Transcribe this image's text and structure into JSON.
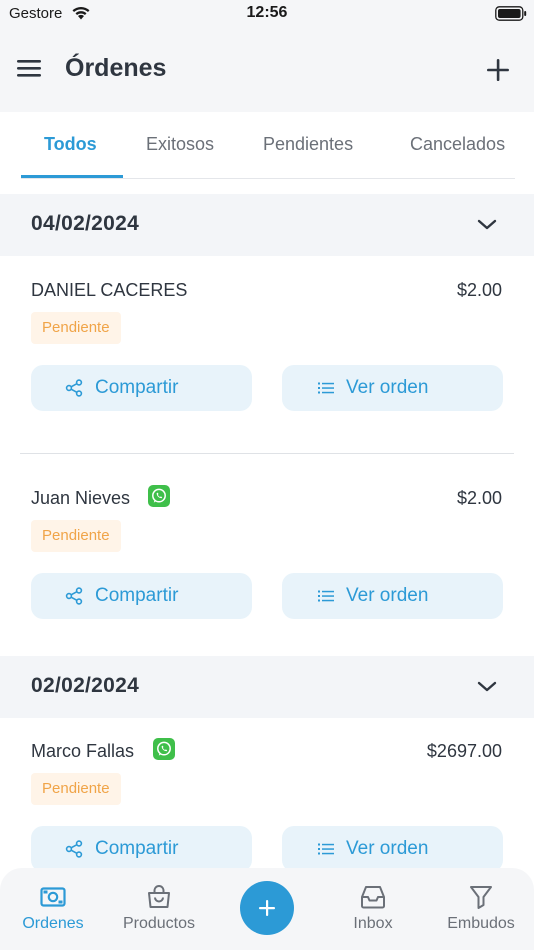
{
  "status_bar": {
    "carrier": "Gestore",
    "time": "12:56"
  },
  "header": {
    "title": "Órdenes"
  },
  "tabs": [
    {
      "label": "Todos",
      "active": true
    },
    {
      "label": "Exitosos",
      "active": false
    },
    {
      "label": "Pendientes",
      "active": false
    },
    {
      "label": "Cancelados",
      "active": false
    }
  ],
  "groups": [
    {
      "date": "04/02/2024",
      "orders": [
        {
          "customer": "DANIEL CACERES",
          "amount": "$2.00",
          "status": "Pendiente",
          "whatsapp": false,
          "share_label": "Compartir",
          "view_label": "Ver orden"
        },
        {
          "customer": "Juan Nieves",
          "amount": "$2.00",
          "status": "Pendiente",
          "whatsapp": true,
          "share_label": "Compartir",
          "view_label": "Ver orden"
        }
      ]
    },
    {
      "date": "02/02/2024",
      "orders": [
        {
          "customer": "Marco Fallas",
          "amount": "$2697.00",
          "status": "Pendiente",
          "whatsapp": true,
          "share_label": "Compartir",
          "view_label": "Ver orden"
        }
      ]
    }
  ],
  "bottom_nav": [
    {
      "label": "Ordenes",
      "icon": "orders-icon",
      "active": true
    },
    {
      "label": "Productos",
      "icon": "bag-icon",
      "active": false
    },
    {
      "label": "Inbox",
      "icon": "inbox-icon",
      "active": false
    },
    {
      "label": "Embudos",
      "icon": "funnel-icon",
      "active": false
    }
  ],
  "colors": {
    "accent": "#2c9ad6",
    "pending_text": "#f0a448",
    "pending_bg": "#fff4e8",
    "whatsapp": "#3fbf4a"
  }
}
